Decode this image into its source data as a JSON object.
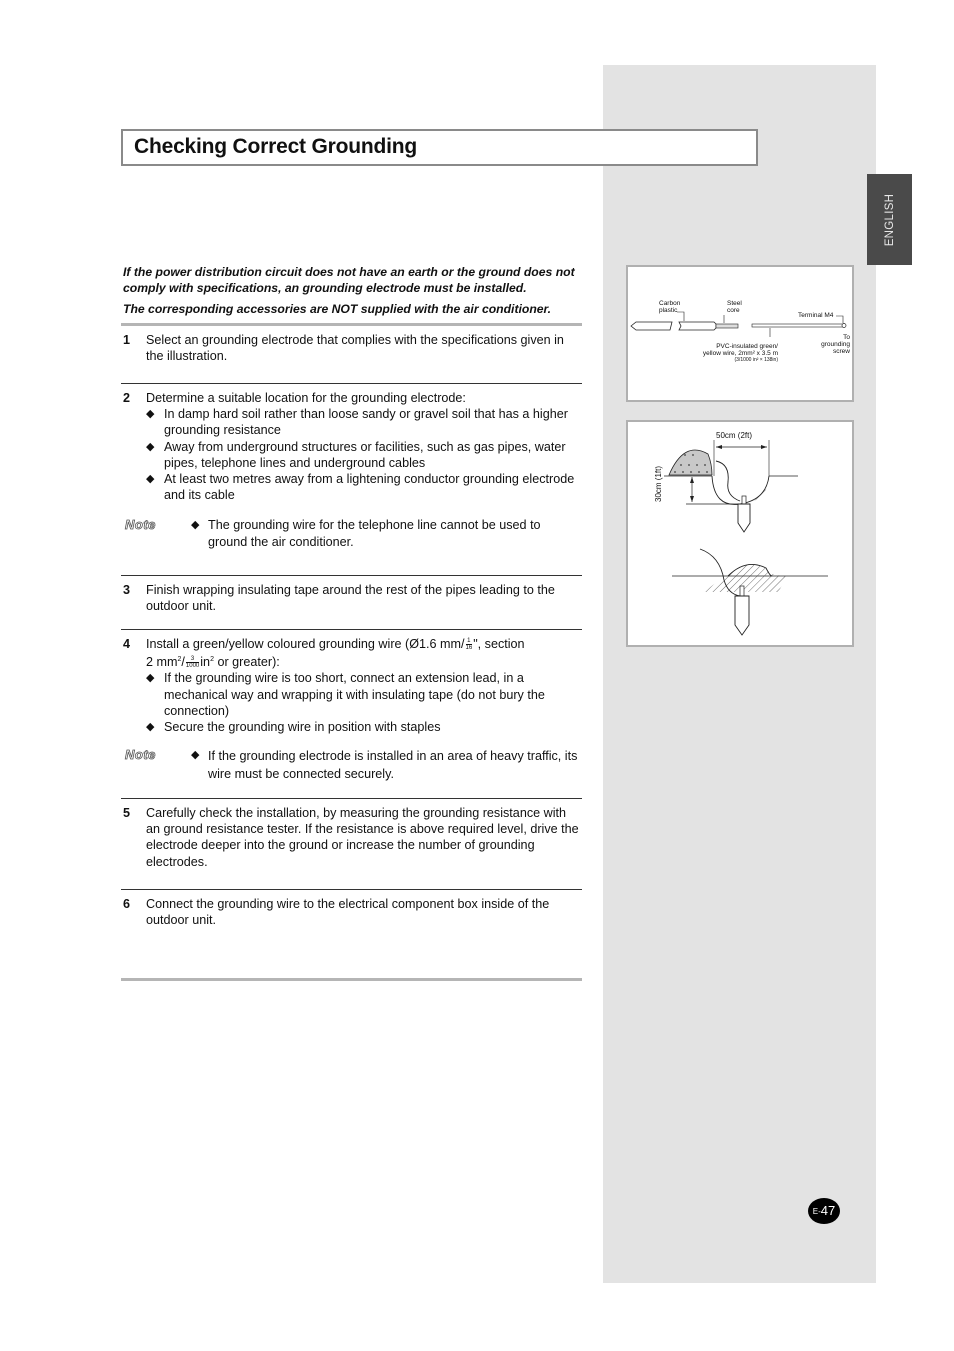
{
  "page": {
    "title": "Checking Correct Grounding",
    "language_tab": "ENGLISH",
    "page_number_prefix": "E-",
    "page_number": "47"
  },
  "intro": {
    "line1": "If the power distribution circuit does not have an earth or the ground does not comply with specifications, an grounding electrode must be installed.",
    "line2": "The corresponding accessories are NOT supplied with the air conditioner."
  },
  "steps": [
    {
      "number": "1",
      "text": "Select an grounding electrode that complies with the specifications given in the illustration."
    },
    {
      "number": "2",
      "text": "Determine a suitable location for the grounding electrode:",
      "bullets": [
        "In damp hard soil rather than loose sandy or gravel soil that has a higher grounding resistance",
        "Away from underground structures or facilities, such as gas pipes, water pipes, telephone lines and underground cables",
        "At least two metres away from a lightening conductor grounding electrode and its cable"
      ],
      "note_label": "Note",
      "note": "The grounding wire for the telephone line cannot be used to ground the air conditioner."
    },
    {
      "number": "3",
      "text": "Finish wrapping insulating tape around the rest of the pipes leading to the outdoor unit."
    },
    {
      "number": "4",
      "text_part1": "Install a green/yellow coloured grounding wire (Ø1.6 mm/",
      "frac1_num": "1",
      "frac1_den": "16",
      "text_part2": "\", section",
      "text_part3": "2 mm",
      "sup": "2",
      "text_part4": "/",
      "frac2_num": "3",
      "frac2_den": "1000",
      "text_part5": "in",
      "text_part6": " or greater):",
      "bullets": [
        "If the grounding wire is too short, connect an extension lead, in a mechanical way and wrapping it with insulating tape (do not bury the connection)",
        "Secure the grounding wire in position with staples"
      ],
      "note_label": "Note",
      "note": "If the grounding electrode is installed in an area of heavy traffic, its wire must be connected securely."
    },
    {
      "number": "5",
      "text": "Carefully check the installation, by measuring the grounding resistance with an ground resistance tester. If the resistance is above required level, drive the electrode deeper into the ground or increase the number of grounding electrodes."
    },
    {
      "number": "6",
      "text": "Connect the grounding wire to the electrical component box inside of the outdoor unit."
    }
  ],
  "figure_electrode": {
    "carbon_plastic": "Carbon plastic",
    "steel_core": "Steel core",
    "terminal": "Terminal M4",
    "pvc_wire_line1": "PVC-insulated green/",
    "pvc_wire_line2": "yellow wire, 2mm² x 3.5 m",
    "pvc_wire_line3": "(3/1000 in² × 138in)",
    "to_grounding_screw": "To grounding screw"
  },
  "figure_installation": {
    "width_label": "50cm (2ft)",
    "depth_label": "30cm (1ft)"
  },
  "colors": {
    "sidebar_bg": "#e3e3e3",
    "language_tab_bg": "#4a4a4a",
    "title_border": "#8a8a8a",
    "rule_gray": "#b5b5b5"
  }
}
